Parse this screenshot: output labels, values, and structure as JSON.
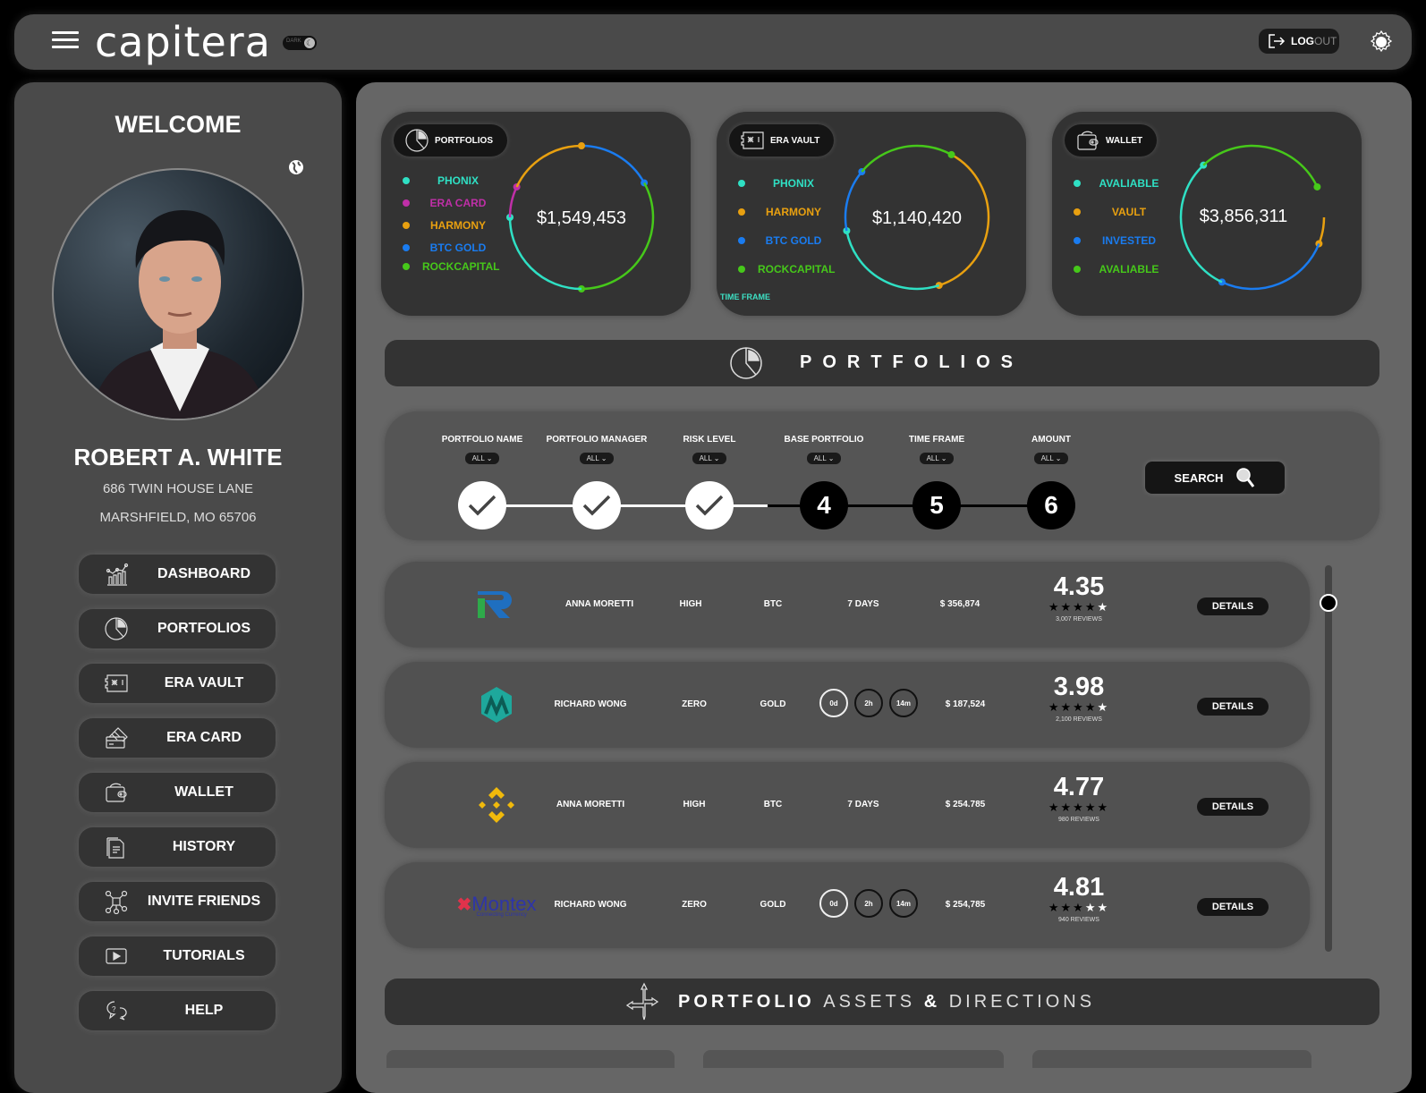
{
  "header": {
    "brand": "capitera",
    "theme_toggle_label": "DARK",
    "logout_bold": "LOG",
    "logout_light": "OUT"
  },
  "sidebar": {
    "welcome": "WELCOME",
    "user_name": "ROBERT A. WHITE",
    "address_line1": "686 TWIN HOUSE LANE",
    "address_line2": "MARSHFIELD, MO 65706",
    "items": [
      {
        "label": "DASHBOARD",
        "icon": "chart-icon"
      },
      {
        "label": "PORTFOLIOS",
        "icon": "pie-chart-icon"
      },
      {
        "label": "ERA VAULT",
        "icon": "vault-icon"
      },
      {
        "label": "ERA CARD",
        "icon": "card-icon"
      },
      {
        "label": "WALLET",
        "icon": "wallet-icon"
      },
      {
        "label": "HISTORY",
        "icon": "document-icon"
      },
      {
        "label": "INVITE FRIENDS",
        "icon": "network-icon"
      },
      {
        "label": "TUTORIALS",
        "icon": "play-icon"
      },
      {
        "label": "HELP",
        "icon": "help-chat-icon"
      }
    ]
  },
  "summary_cards": [
    {
      "title": "PORTFOLIOS",
      "total": "$1,549,453",
      "legend": [
        {
          "label": "PHONIX",
          "color": "#2fe0c4"
        },
        {
          "label": "ERA CARD",
          "color": "#c02fa8"
        },
        {
          "label": "HARMONY",
          "color": "#e8a010"
        },
        {
          "label": "BTC GOLD",
          "color": "#1a7cf0"
        },
        {
          "label": "ROCKCAPITAL",
          "color": "#46c81a"
        }
      ]
    },
    {
      "title": "ERA VAULT",
      "total": "$1,140,420",
      "footer": "TIME FRAME",
      "legend": [
        {
          "label": "PHONIX",
          "color": "#2fe0c4"
        },
        {
          "label": "HARMONY",
          "color": "#e8a010"
        },
        {
          "label": "BTC GOLD",
          "color": "#1a7cf0"
        },
        {
          "label": "ROCKCAPITAL",
          "color": "#46c81a"
        }
      ]
    },
    {
      "title": "WALLET",
      "total": "$3,856,311",
      "legend": [
        {
          "label": "AVALIABLE",
          "color": "#2fe0c4"
        },
        {
          "label": "VAULT",
          "color": "#e8a010"
        },
        {
          "label": "INVESTED",
          "color": "#1a7cf0"
        },
        {
          "label": "AVALIABLE",
          "color": "#46c81a"
        }
      ]
    }
  ],
  "portfolios_banner": "PORTFOLIOS",
  "filters": {
    "columns": [
      {
        "label": "PORTFOLIO NAME",
        "value": "ALL",
        "step": "✓",
        "done": true
      },
      {
        "label": "PORTFOLIO MANAGER",
        "value": "ALL",
        "step": "✓",
        "done": true
      },
      {
        "label": "RISK LEVEL",
        "value": "ALL",
        "step": "✓",
        "done": true
      },
      {
        "label": "BASE PORTFOLIO",
        "value": "ALL",
        "step": "4",
        "done": false
      },
      {
        "label": "TIME FRAME",
        "value": "ALL",
        "step": "5",
        "done": false
      },
      {
        "label": "AMOUNT",
        "value": "ALL",
        "step": "6",
        "done": false
      }
    ],
    "search_label": "SEARCH"
  },
  "rows": [
    {
      "logo": "R",
      "manager": "ANNA MORETTI",
      "risk": "HIGH",
      "base": "BTC",
      "timeframe": "7 DAYS",
      "amount": "$ 356,874",
      "rating": "4.35",
      "stars": 4,
      "reviews": "3,007 REVIEWS",
      "details": "DETAILS"
    },
    {
      "logo": "M",
      "manager": "RICHARD WONG",
      "risk": "ZERO",
      "base": "GOLD",
      "timers": [
        "0d",
        "2h",
        "14m"
      ],
      "amount": "$ 187,524",
      "rating": "3.98",
      "stars": 3.5,
      "reviews": "2,100 REVIEWS",
      "details": "DETAILS"
    },
    {
      "logo": "binance",
      "manager": "ANNA MORETTI",
      "risk": "HIGH",
      "base": "BTC",
      "timeframe": "7 DAYS",
      "amount": "$ 254.785",
      "rating": "4.77",
      "stars": 4.5,
      "reviews": "980 REVIEWS",
      "details": "DETAILS"
    },
    {
      "logo": "Montex",
      "logo_sub": "Connecting Currency",
      "manager": "RICHARD WONG",
      "risk": "ZERO",
      "base": "GOLD",
      "timers": [
        "0d",
        "2h",
        "14m"
      ],
      "amount": "$ 254,785",
      "rating": "4.81",
      "stars": 3,
      "reviews": "940 REVIEWS",
      "details": "DETAILS"
    }
  ],
  "assets_banner": {
    "bold": "PORTFOLIO",
    "light1": "ASSETS",
    "amp": "&",
    "light2": "DIRECTIONS"
  }
}
